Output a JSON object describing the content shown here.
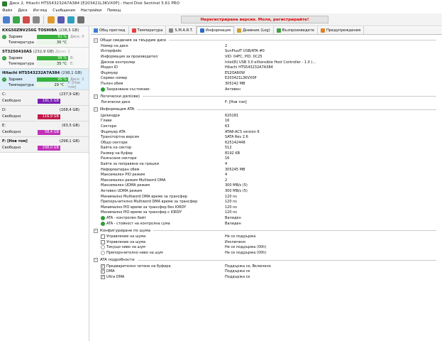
{
  "window": {
    "title": "Диск 2, Hitachi HTS543232A7A384 [E203421L3KVX0P] - Hard Disk Sentinel 5.61 PRO"
  },
  "menu": [
    "Файл",
    "Диск",
    "Изглед",
    "Съобщения",
    "Настройки",
    "Помощ"
  ],
  "toolbar": {
    "unregistered": "Нерегистрирана версия. Моля, регистрирайте!"
  },
  "labels": {
    "health": "Здраве",
    "temperature": "Температура",
    "free": "Свободно"
  },
  "disks": [
    {
      "name": "KXG50ZNV256G TOSHIBA",
      "size": "(238,5 GB)",
      "extra": "Диск: 0",
      "health": "91 %",
      "health_pct": 91,
      "health_val": "91",
      "temp": "30 °C",
      "temp_val": "30"
    },
    {
      "name": "ST3250410AS",
      "size": "(232,9 GB)",
      "extra": "Диск: 1",
      "health": "98 %",
      "health_pct": 98,
      "health_val": "B:",
      "temp": "35 °C",
      "temp_val": "E:"
    },
    {
      "name": "Hitachi HTS543232A7A384",
      "size": "(298,1 GB)",
      "extra": "Диск: 2",
      "health": "90 %",
      "health_pct": 90,
      "health_val": "Диск: 2",
      "temp": "29 °C",
      "temp_val": "F: [Нов том]"
    }
  ],
  "volumes": [
    {
      "name": "C:",
      "size": "(237,9 GB)",
      "free": "191,5 GB",
      "color": "purple"
    },
    {
      "name": "D:",
      "size": "(168,4 GB)",
      "free": "116,9 GB",
      "color": "red"
    },
    {
      "name": "E:",
      "size": "(63,5 GB)",
      "free": "58,4 GB",
      "color": "pink"
    },
    {
      "name": "F: [Нов том]",
      "size": "(298,1 GB)",
      "free": "298,0 GB",
      "color": "pink"
    }
  ],
  "tabs": [
    "Общ преглед",
    "Температура",
    "S.M.A.R.T.",
    "Информация",
    "Дневник (Log)",
    "Възпроизведете",
    "Предупреждения"
  ],
  "sections": {
    "general": {
      "title": "Общи сведения за твърдия диск",
      "rows": [
        {
          "k": "Номер на диск",
          "v": "2"
        },
        {
          "k": "Интерфейс",
          "v": "SunPlusIT USB/ATA #0"
        },
        {
          "k": "Информация за производител",
          "v": "VID: 04FC, PID: 0C25"
        },
        {
          "k": "Дисков контролер",
          "v": "Intel(R) USB 3.0 eXtensible Host Controller - 1.0 (..."
        },
        {
          "k": "Модел ID",
          "v": "Hitachi HTS543232A7A384"
        },
        {
          "k": "Фърмуер",
          "v": "ES2OA60W"
        },
        {
          "k": "Сериен номер",
          "v": "E203421L3KVX0P"
        },
        {
          "k": "Пълен обем",
          "v": "305242 MB"
        },
        {
          "k": "Захранване състояние:",
          "v": "Активен",
          "icon": "power"
        }
      ]
    },
    "logical": {
      "title": "Логически дял(ове)",
      "rows": [
        {
          "k": "Логически диск",
          "v": "F: [Нов том]"
        }
      ]
    },
    "ata": {
      "title": "Информация ATA",
      "rows": [
        {
          "k": "Цилиндри",
          "v": "620181"
        },
        {
          "k": "Глави",
          "v": "16"
        },
        {
          "k": "Сектори",
          "v": "63"
        },
        {
          "k": "Фърмуер ATA",
          "v": "ATA8-ACS version 6"
        },
        {
          "k": "Транспортна версия",
          "v": "SATA Rev 2.6"
        },
        {
          "k": "Общо сектори",
          "v": "625142448"
        },
        {
          "k": "Байта на сектор",
          "v": "512"
        },
        {
          "k": "Размер на буфер",
          "v": "8192 KB"
        },
        {
          "k": "Разкъсани сектори",
          "v": "16"
        },
        {
          "k": "Байте за поправяне на грешки",
          "v": "4"
        },
        {
          "k": "Неформатиран обем",
          "v": "305245 MB"
        },
        {
          "k": "Максимален PIO режим",
          "v": "4"
        },
        {
          "k": "Максимален режим Multiword DMA",
          "v": "2"
        },
        {
          "k": "Максимален UDMA режим",
          "v": "300 MB/s (5)"
        },
        {
          "k": "Активен UDMA режим",
          "v": "300 MB/s (5)"
        },
        {
          "k": "Минимално Multiword DMA време за трансфер",
          "v": "120 ns"
        },
        {
          "k": "Препоръчително Multiword DMA време за трансфер",
          "v": "120 ns"
        },
        {
          "k": "Минимално PIO време за трансфер без IORDY",
          "v": "120 ns"
        },
        {
          "k": "Минимално PIO време за трансфер с IORDY",
          "v": "120 ns"
        },
        {
          "k": "ATA - контролен байт",
          "v": "Валиден",
          "icon": "ok"
        },
        {
          "k": "ATA - стойност на контролна сума",
          "v": "Валиден",
          "icon": "ok"
        }
      ]
    },
    "noise": {
      "title": "Конфигуриране по шума",
      "rows": [
        {
          "k": "Управление на шума",
          "v": "Не се поддържа",
          "icon": "checkbox"
        },
        {
          "k": "Управление на шума",
          "v": "Изключено",
          "icon": "checkbox"
        },
        {
          "k": "Текущо ниво на шум",
          "v": "Не се поддържа (00h)",
          "icon": "radio"
        },
        {
          "k": "Препоръчително ниво на шум",
          "v": "Не се поддържа (00h)",
          "icon": "radio"
        }
      ]
    },
    "ata_features": {
      "title": "ATA подробности",
      "rows": [
        {
          "k": "Предварително четене на буфера",
          "v": "Поддържа се, Включено",
          "icon": "checked"
        },
        {
          "k": "DMA",
          "v": "Поддържа се",
          "icon": "checked"
        },
        {
          "k": "Ultra DMA",
          "v": "Поддържа се",
          "icon": "checked"
        }
      ]
    }
  },
  "colors": {
    "health_green": "#38b23b",
    "vol_purple": "#7a1fb3",
    "vol_red": "#c11a4a",
    "vol_pink": "#c030b8",
    "unreg_red": "#dd0000",
    "selected_bg": "#dbeefa"
  }
}
